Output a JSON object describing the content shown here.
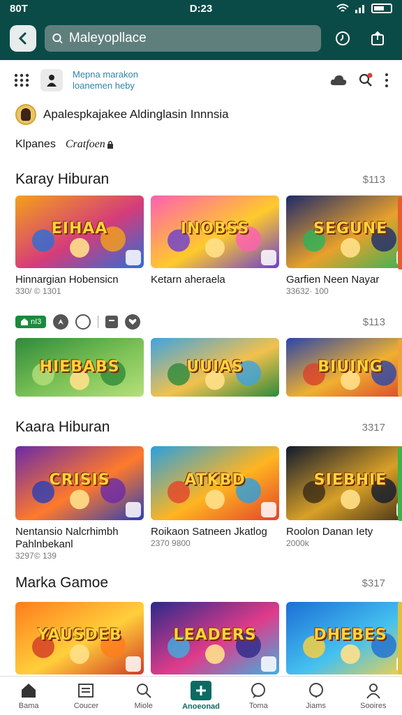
{
  "status_bar": {
    "left": "80T",
    "time": "D:23"
  },
  "search": {
    "value": "Maleyopllace"
  },
  "promo": {
    "line1": "Mepna marakon",
    "line2": "loanemen heby"
  },
  "user": {
    "name": "Apalespkajakee  Aldinglasin Innnsia"
  },
  "tabs": [
    "Klpanes",
    "Cratfoen"
  ],
  "sections": [
    {
      "title": "Karay Hiburan",
      "count": "$113",
      "cards": [
        {
          "name": "Hinnargian Hobensicn",
          "sub": "330/ © 1301",
          "thumb_text": "EIHAA",
          "colors": [
            "#f4a11a",
            "#d43c7a",
            "#2b6fd6"
          ]
        },
        {
          "name": "Ketarn aheraela",
          "sub": "",
          "thumb_text": "INOBSS",
          "colors": [
            "#ff5fb2",
            "#ffca2b",
            "#6a3fd0"
          ]
        },
        {
          "name": "Garfien Neen Nayar",
          "sub": "33632· 100",
          "thumb_text": "SEGUNE",
          "colors": [
            "#1e2a6b",
            "#e8a12b",
            "#2bb45a"
          ]
        }
      ]
    },
    {
      "title": "",
      "count": "$113",
      "cards": [
        {
          "name": "",
          "sub": "",
          "thumb_text": "HIEBABS",
          "colors": [
            "#2f8a3a",
            "#7cc256",
            "#b5e07a"
          ]
        },
        {
          "name": "",
          "sub": "",
          "thumb_text": "UUIAS",
          "colors": [
            "#3fa3e0",
            "#f2c14e",
            "#2d8a3c"
          ]
        },
        {
          "name": "",
          "sub": "",
          "thumb_text": "BIUING",
          "colors": [
            "#2c46a8",
            "#f0b030",
            "#d9412b"
          ]
        }
      ]
    },
    {
      "title": "Kaara Hiburan",
      "count": "3317",
      "cards": [
        {
          "name": "Nentansio Nalcrhimbh",
          "sub": "Pahlnbekanl",
          "sub2": "3297© 139",
          "thumb_text": "CRISIS",
          "colors": [
            "#6b2aa8",
            "#ff7a2b",
            "#2b3fb5"
          ]
        },
        {
          "name": "Roikaon Satneen Jkatlog",
          "sub": "2370 9800",
          "thumb_text": "ATKBD",
          "colors": [
            "#2aa0e0",
            "#ffb520",
            "#e2432b"
          ]
        },
        {
          "name": "Roolon Danan Iety",
          "sub": "2000k",
          "thumb_text": "SIEBHIE",
          "colors": [
            "#111a2e",
            "#d8a027",
            "#3a2a17"
          ]
        }
      ]
    },
    {
      "title": "Marka Gamoe",
      "count": "$317",
      "cards": [
        {
          "name": "",
          "sub": "",
          "thumb_text": "YAUSDEB",
          "colors": [
            "#ff7d1c",
            "#ffcf3b",
            "#d23a24"
          ]
        },
        {
          "name": "",
          "sub": "",
          "thumb_text": "LEADERS",
          "colors": [
            "#2b2a8a",
            "#e03b8a",
            "#3fb0e0"
          ]
        },
        {
          "name": "",
          "sub": "",
          "thumb_text": "DHEBES",
          "colors": [
            "#1c6fd6",
            "#45c1f0",
            "#ffd23a"
          ]
        }
      ]
    }
  ],
  "chip_label": "nI3",
  "bottom_nav": [
    {
      "label": "Bama"
    },
    {
      "label": "Coucer"
    },
    {
      "label": "Miole"
    },
    {
      "label": "Anoeonad"
    },
    {
      "label": "Toma"
    },
    {
      "label": "Jiams"
    },
    {
      "label": "Sooires"
    }
  ],
  "colors": {
    "header": "#0b4b47",
    "accent": "#0b6b63",
    "chip": "#1b8a3d"
  }
}
